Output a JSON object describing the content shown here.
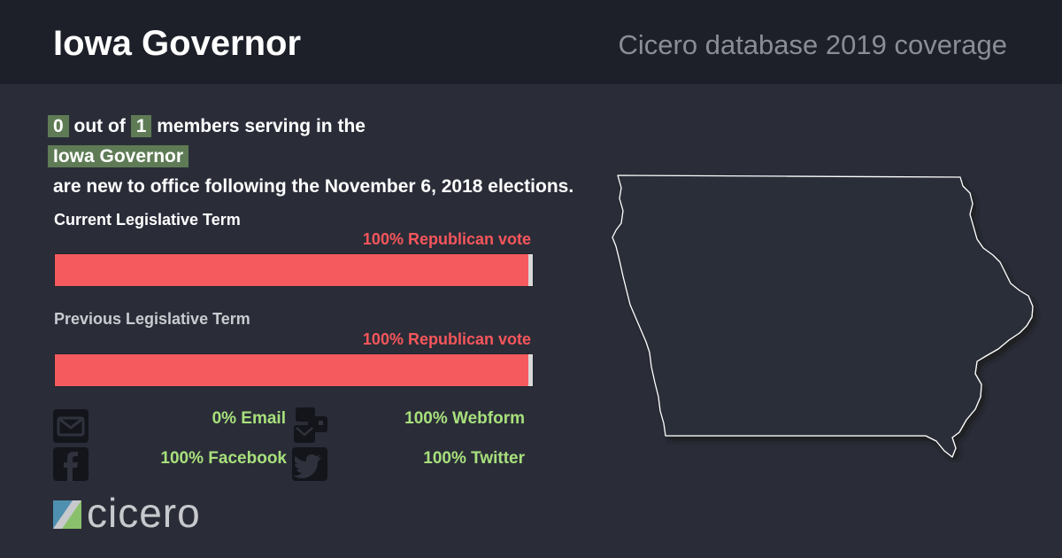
{
  "header": {
    "title": "Iowa Governor",
    "subtitle": "Cicero database 2019 coverage"
  },
  "headline": {
    "new_count": "0",
    "out_of_text": "out of",
    "total_count": "1",
    "members_text": "members serving in the",
    "chamber": "Iowa Governor",
    "tail_text": "are new to office following the November 6, 2018 elections."
  },
  "terms": {
    "current": {
      "label": "Current Legislative Term",
      "vote_text": "100% Republican vote",
      "republican_share": 1.0
    },
    "previous": {
      "label": "Previous Legislative Term",
      "vote_text": "100% Republican vote",
      "republican_share": 1.0
    }
  },
  "contacts": {
    "email": {
      "label": "0% Email",
      "icon": "envelope-icon"
    },
    "webform": {
      "label": "100% Webform",
      "icon": "webform-icon"
    },
    "facebook": {
      "label": "100% Facebook",
      "icon": "facebook-icon"
    },
    "twitter": {
      "label": "100% Twitter",
      "icon": "twitter-icon"
    }
  },
  "logo": {
    "text": "cicero"
  },
  "colors": {
    "background": "#2a2d38",
    "header_background": "#1d2029",
    "highlight": "#5e7b55",
    "republican": "#f55a5f",
    "contact_green": "#a8e07c"
  }
}
